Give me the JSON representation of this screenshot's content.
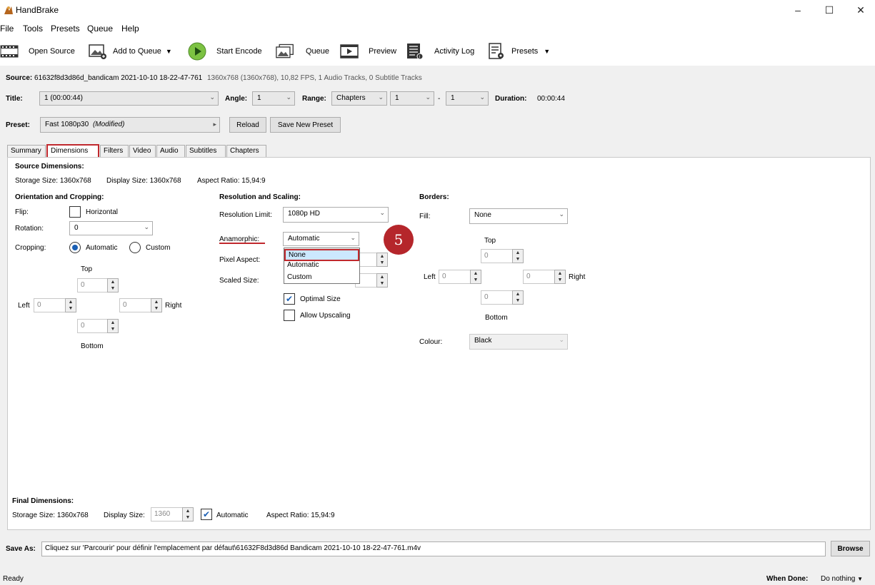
{
  "app": {
    "title": "HandBrake",
    "minimize": "–",
    "maximize": "☐",
    "close": "✕"
  },
  "menu": [
    "File",
    "Tools",
    "Presets",
    "Queue",
    "Help"
  ],
  "toolbar": {
    "open_source": "Open Source",
    "add_to_queue": "Add to Queue",
    "start_encode": "Start Encode",
    "queue": "Queue",
    "preview": "Preview",
    "activity_log": "Activity Log",
    "presets": "Presets"
  },
  "source": {
    "label": "Source:",
    "name": "61632f8d3d86d_bandicam 2021-10-10 18-22-47-761",
    "info": "1360x768 (1360x768), 10,82 FPS, 1 Audio Tracks, 0 Subtitle Tracks"
  },
  "title_row": {
    "title_label": "Title:",
    "title_value": "1 (00:00:44)",
    "angle_label": "Angle:",
    "angle_value": "1",
    "range_label": "Range:",
    "range_value": "Chapters",
    "range_from": "1",
    "range_dash": "-",
    "range_to": "1",
    "duration_label": "Duration:",
    "duration_value": "00:00:44"
  },
  "preset": {
    "label": "Preset:",
    "value": "Fast 1080p30",
    "modified": "(Modified)",
    "reload": "Reload",
    "save_new": "Save New Preset"
  },
  "tabs": [
    "Summary",
    "Dimensions",
    "Filters",
    "Video",
    "Audio",
    "Subtitles",
    "Chapters"
  ],
  "active_tab": "Dimensions",
  "source_dims": {
    "heading": "Source Dimensions:",
    "storage": "Storage Size: 1360x768",
    "display": "Display Size: 1360x768",
    "aspect": "Aspect Ratio: 15,94:9"
  },
  "orientation": {
    "heading": "Orientation and Cropping:",
    "flip_label": "Flip:",
    "flip_option": "Horizontal",
    "rotation_label": "Rotation:",
    "rotation_value": "0",
    "cropping_label": "Cropping:",
    "crop_auto": "Automatic",
    "crop_custom": "Custom",
    "top_label": "Top",
    "left_label": "Left",
    "right_label": "Right",
    "bottom_label": "Bottom",
    "top": "0",
    "left": "0",
    "right": "0",
    "bottom": "0"
  },
  "resolution": {
    "heading": "Resolution and Scaling:",
    "limit_label": "Resolution Limit:",
    "limit_value": "1080p HD",
    "anamorphic_label": "Anamorphic:",
    "anamorphic_value": "Automatic",
    "pixel_aspect_label": "Pixel Aspect:",
    "scaled_size_label": "Scaled Size:",
    "optimal_size": "Optimal Size",
    "allow_upscaling": "Allow Upscaling",
    "dropdown_options": [
      "None",
      "Automatic",
      "Custom"
    ]
  },
  "borders": {
    "heading": "Borders:",
    "fill_label": "Fill:",
    "fill_value": "None",
    "top_label": "Top",
    "left_label": "Left",
    "right_label": "Right",
    "bottom_label": "Bottom",
    "top": "0",
    "left": "0",
    "right": "0",
    "bottom": "0",
    "colour_label": "Colour:",
    "colour_value": "Black"
  },
  "step_badge": "5",
  "final_dims": {
    "heading": "Final Dimensions:",
    "storage": "Storage Size: 1360x768",
    "display_label": "Display Size:",
    "display_value": "1360",
    "automatic": "Automatic",
    "aspect": "Aspect Ratio: 15,94:9"
  },
  "save_as": {
    "label": "Save As:",
    "value": "Cliquez sur 'Parcourir' pour définir l'emplacement par défaut\\61632F8d3d86d Bandicam 2021-10-10 18-22-47-761.m4v",
    "browse": "Browse"
  },
  "status": {
    "text": "Ready",
    "when_done_label": "When Done:",
    "when_done_value": "Do nothing"
  },
  "colors": {
    "highlight_red": "#c0282d",
    "badge": "#b5262b",
    "check_blue": "#1a5fb4"
  }
}
